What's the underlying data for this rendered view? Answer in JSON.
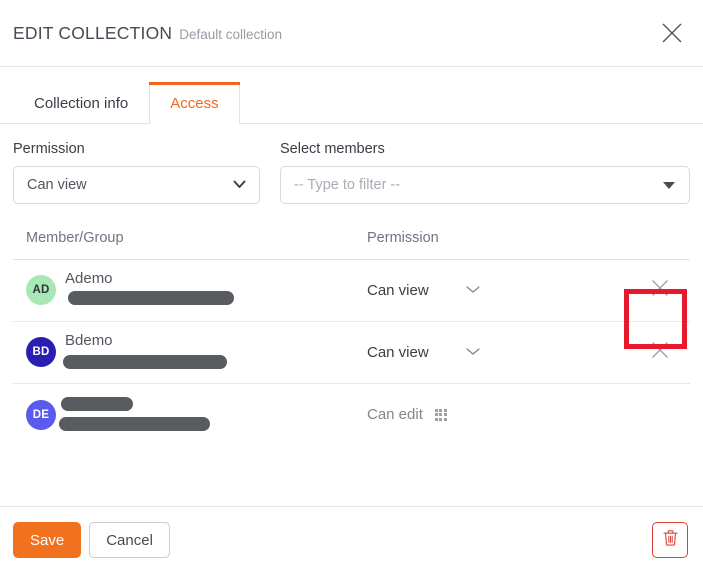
{
  "header": {
    "title": "EDIT COLLECTION",
    "subtitle": "Default collection",
    "close_icon": "close-icon"
  },
  "tabs": [
    {
      "label": "Collection info",
      "active": false
    },
    {
      "label": "Access",
      "active": true
    }
  ],
  "form": {
    "permission": {
      "label": "Permission",
      "value": "Can view"
    },
    "members": {
      "label": "Select members",
      "placeholder": "-- Type to filter --"
    }
  },
  "table": {
    "columns": {
      "member": "Member/Group",
      "permission": "Permission"
    },
    "rows": [
      {
        "initials": "AD",
        "avatar_bg": "#a8e8b6",
        "avatar_fg": "#33333c",
        "name": "Ademo",
        "name_redacted": false,
        "permission": "Can view",
        "permission_muted": false,
        "has_chevron": true,
        "has_grid_icon": false,
        "has_remove": true,
        "highlighted": true
      },
      {
        "initials": "BD",
        "avatar_bg": "#2a1fb0",
        "avatar_fg": "#ffffff",
        "name": "Bdemo",
        "name_redacted": false,
        "permission": "Can view",
        "permission_muted": false,
        "has_chevron": true,
        "has_grid_icon": false,
        "has_remove": true,
        "highlighted": false
      },
      {
        "initials": "DE",
        "avatar_bg": "#5a5af0",
        "avatar_fg": "#ffffff",
        "name": "",
        "name_redacted": true,
        "permission": "Can edit",
        "permission_muted": true,
        "has_chevron": false,
        "has_grid_icon": true,
        "has_remove": false,
        "highlighted": false
      }
    ]
  },
  "footer": {
    "save_label": "Save",
    "cancel_label": "Cancel",
    "delete_icon": "trash-icon"
  },
  "colors": {
    "accent_orange": "#f2671f",
    "save_orange": "#f2711f",
    "annotation_red": "#e8192c",
    "delete_red": "#d94436"
  }
}
